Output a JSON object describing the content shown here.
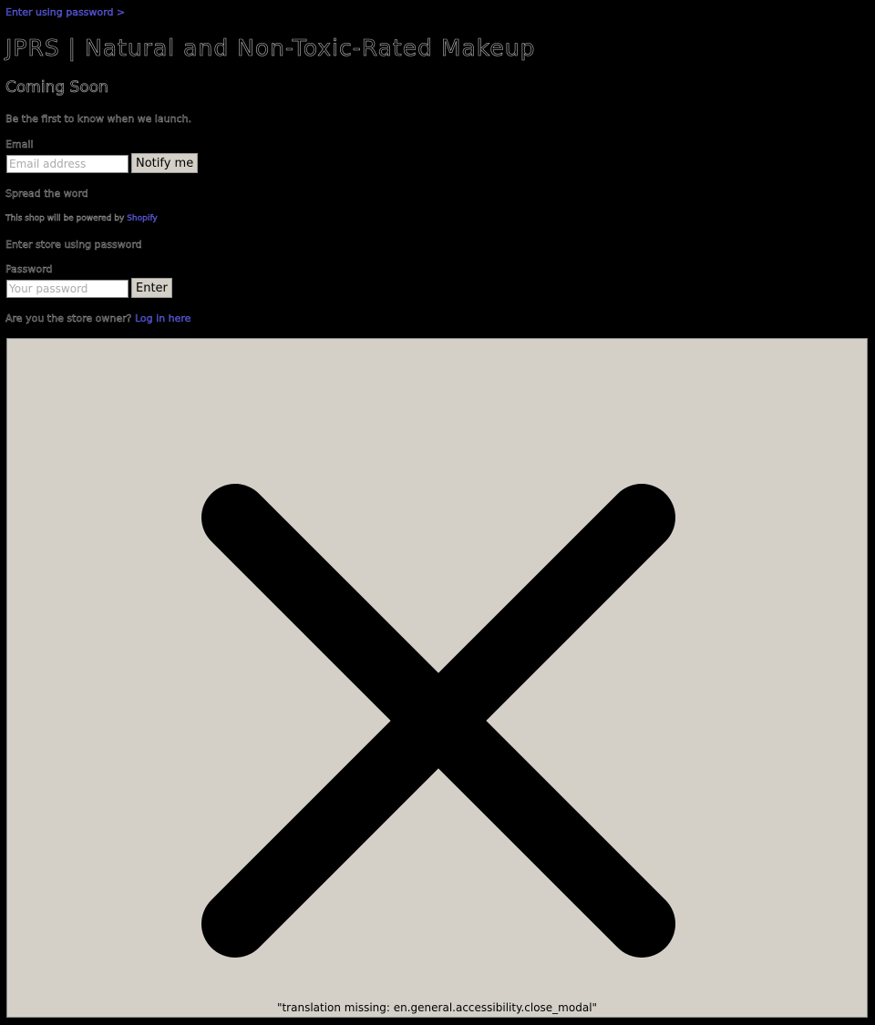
{
  "top_link": "Enter using password  >",
  "title": "JPRS | Natural and Non-Toxic-Rated Makeup",
  "coming_soon": "Coming Soon",
  "tagline": "Be the first to know when we launch.",
  "email": {
    "label": "Email",
    "placeholder": "Email address",
    "button": "Notify me"
  },
  "spread": "Spread the word",
  "powered": {
    "text": "This shop will be powered by ",
    "link": "Shopify"
  },
  "enter_store": "Enter store using password",
  "password": {
    "label": "Password",
    "placeholder": "Your password",
    "button": "Enter"
  },
  "owner": {
    "text": "Are you the store owner? ",
    "link": "Log in here"
  },
  "modal": {
    "close_icon": "close-x-icon",
    "caption": "\"translation missing: en.general.accessibility.close_modal\""
  },
  "colors": {
    "background": "#000000",
    "modal": "#d4d0c8",
    "link": "#6a6aff"
  }
}
